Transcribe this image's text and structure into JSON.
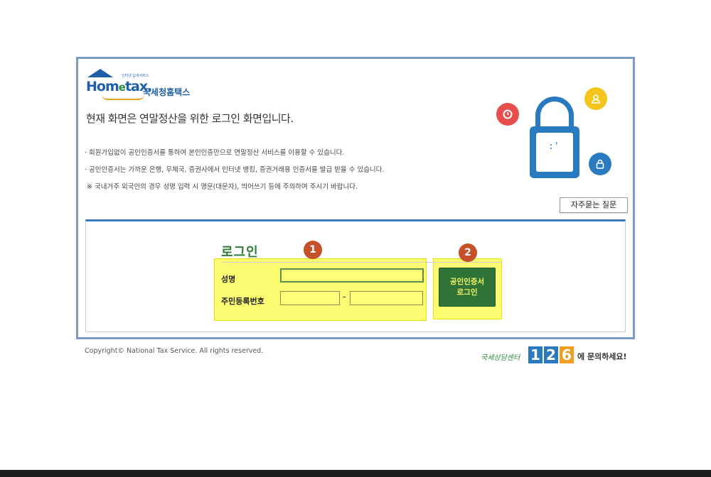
{
  "logo": {
    "brand": "Hometax",
    "tagline": "인터넷 납세서비스",
    "korean": "국세청홈택스"
  },
  "headline": "현재 화면은 연말정산을 위한 로그인 화면입니다.",
  "bullets": [
    "· 회원가입없이 공인인증서를 통하여 본인인증만으로 연말정산 서비스를 이용할 수 있습니다.",
    "· 공인인증서는 가까운 은행, 우체국, 증권사에서 인터넷 뱅킹, 증권거래용 인증서를 발급 받을 수 있습니다.",
    "※ 국내거주 외국인의 경우 성명 입력 시 영문(대문자), 띄어쓰기 등에 주의하여 주시기 바랍니다."
  ],
  "faq_button": "자주묻는 질문",
  "login": {
    "title": "로그인",
    "name_label": "성명",
    "rrn_label": "주민등록번호",
    "name_value": "",
    "rrn1_value": "",
    "rrn2_value": "",
    "dash": "-",
    "cert_button_line1": "공인인증서",
    "cert_button_line2": "로그인"
  },
  "steps": [
    "1",
    "2"
  ],
  "footer": {
    "copyright": "Copyright© National Tax Service. All rights reserved.",
    "center_prefix": "국세상담센터",
    "center_digits": [
      "1",
      "2",
      "6"
    ],
    "center_suffix": "에 문의하세요!"
  },
  "icons": {
    "illustration": "open-padlock-icon",
    "clock": "clock-icon",
    "user": "user-icon",
    "small_lock": "lock-icon"
  },
  "colors": {
    "frame_border": "#7b9cc4",
    "brand_blue": "#1d5fa8",
    "login_green": "#2e7d3b",
    "highlight_yellow": "#fcfc6c",
    "step_badge": "#c5502a"
  }
}
